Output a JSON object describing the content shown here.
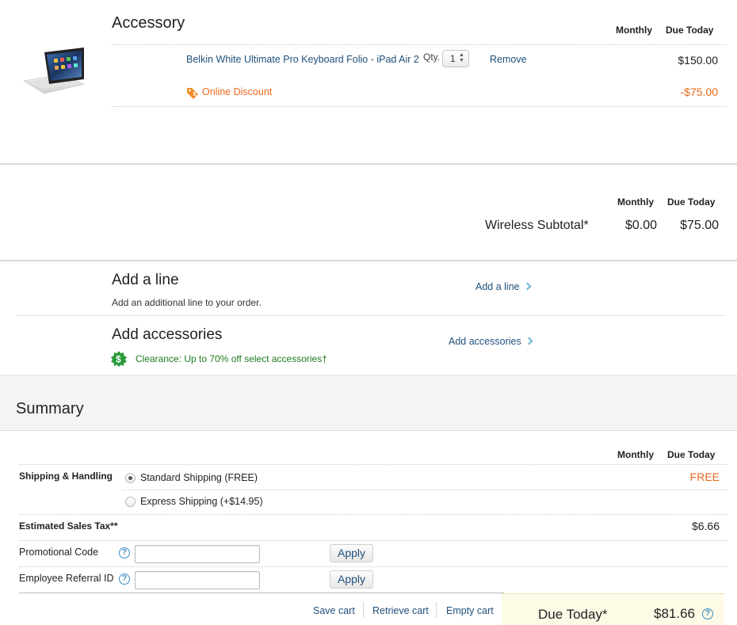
{
  "accessory": {
    "title": "Accessory",
    "col_monthly": "Monthly",
    "col_due_today": "Due Today",
    "product_name": "Belkin White Ultimate Pro Keyboard Folio - iPad Air 2",
    "qty_label": "Qty.",
    "qty_value": "1",
    "remove_label": "Remove",
    "price": "$150.00",
    "discount_label": "Online Discount",
    "discount_amount": "-$75.00"
  },
  "subtotal": {
    "col_monthly": "Monthly",
    "col_due_today": "Due Today",
    "label": "Wireless Subtotal*",
    "monthly": "$0.00",
    "due_today": "$75.00"
  },
  "add_line": {
    "title": "Add a line",
    "description": "Add an additional line to your order.",
    "link": "Add a line"
  },
  "add_accessories": {
    "title": "Add accessories",
    "promo": "Clearance: Up to 70% off select accessories†",
    "link": "Add accessories"
  },
  "summary": {
    "title": "Summary",
    "col_monthly": "Monthly",
    "col_due_today": "Due Today",
    "shipping_label": "Shipping & Handling",
    "shipping_options": [
      {
        "label": "Standard Shipping (FREE)",
        "selected": true
      },
      {
        "label": "Express Shipping (+$14.95)",
        "selected": false
      }
    ],
    "shipping_due": "FREE",
    "tax_label": "Estimated Sales Tax**",
    "tax_due": "$6.66",
    "promo_code_label": "Promotional Code",
    "promo_code_value": "",
    "referral_label": "Employee Referral ID",
    "referral_value": "",
    "apply_label": "Apply",
    "help_icon": "?"
  },
  "footer": {
    "save_cart": "Save cart",
    "retrieve_cart": "Retrieve cart",
    "empty_cart": "Empty cart",
    "due_today_label": "Due Today*",
    "due_today_value": "$81.66"
  },
  "colors": {
    "link": "#1f4f7a",
    "discount_orange": "#e8691c",
    "promo_green": "#1f7a1f",
    "due_today_bg": "#fdfae6",
    "summary_bg": "#f4f4f4"
  }
}
